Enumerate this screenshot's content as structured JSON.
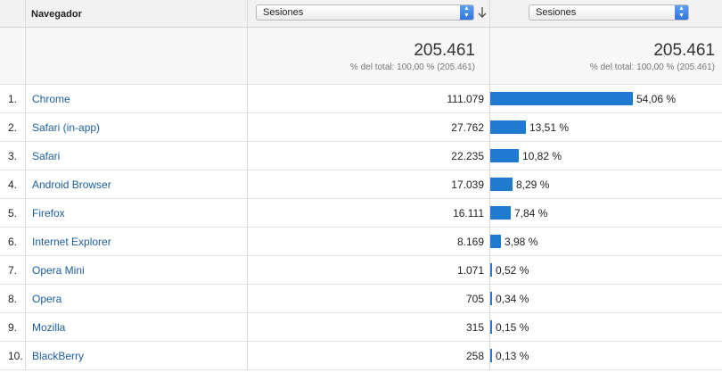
{
  "header": {
    "col_browser": "Navegador",
    "metric_select": "Sesiones",
    "compare_select": "Sesiones"
  },
  "totals": {
    "value": "205.461",
    "subtext": "% del total: 100,00 % (205.461)",
    "value_compare": "205.461",
    "subtext_compare": "% del total: 100,00 % (205.461)"
  },
  "rows": [
    {
      "index": "1.",
      "browser": "Chrome",
      "sessions": "111.079",
      "pct": "54,06 %",
      "share": 0.5406
    },
    {
      "index": "2.",
      "browser": "Safari (in-app)",
      "sessions": "27.762",
      "pct": "13,51 %",
      "share": 0.1351
    },
    {
      "index": "3.",
      "browser": "Safari",
      "sessions": "22.235",
      "pct": "10,82 %",
      "share": 0.1082
    },
    {
      "index": "4.",
      "browser": "Android Browser",
      "sessions": "17.039",
      "pct": "8,29 %",
      "share": 0.0829
    },
    {
      "index": "5.",
      "browser": "Firefox",
      "sessions": "16.111",
      "pct": "7,84 %",
      "share": 0.0784
    },
    {
      "index": "6.",
      "browser": "Internet Explorer",
      "sessions": "8.169",
      "pct": "3,98 %",
      "share": 0.0398
    },
    {
      "index": "7.",
      "browser": "Opera Mini",
      "sessions": "1.071",
      "pct": "0,52 %",
      "share": 0.0052
    },
    {
      "index": "8.",
      "browser": "Opera",
      "sessions": "705",
      "pct": "0,34 %",
      "share": 0.0034
    },
    {
      "index": "9.",
      "browser": "Mozilla",
      "sessions": "315",
      "pct": "0,15 %",
      "share": 0.0015
    },
    {
      "index": "10.",
      "browser": "BlackBerry",
      "sessions": "258",
      "pct": "0,13 %",
      "share": 0.0013
    }
  ],
  "colors": {
    "bar": "#1f7bd0",
    "link": "#1a5e9e"
  }
}
